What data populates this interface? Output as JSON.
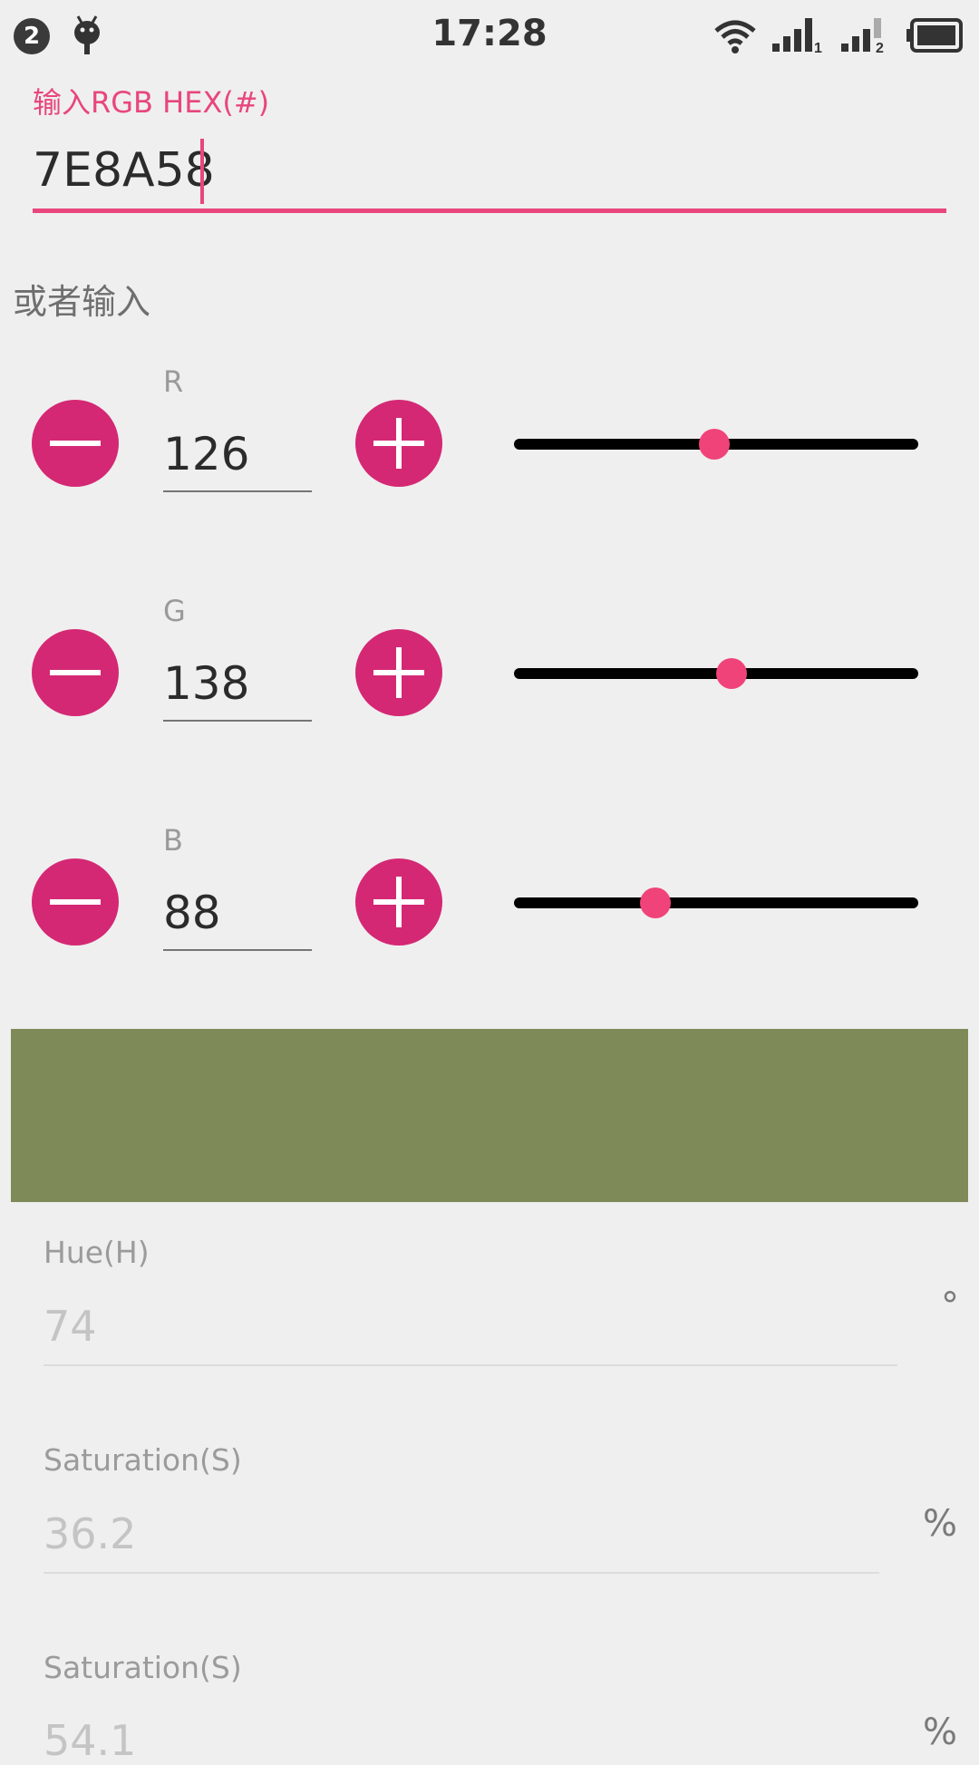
{
  "status_bar": {
    "notification_count": "2",
    "time": "17:28",
    "sim1_label": "1",
    "sim2_label": "2"
  },
  "hex_input": {
    "label": "输入RGB HEX(#)",
    "value": "7E8A58"
  },
  "or_label": "或者输入",
  "channels": [
    {
      "label": "R",
      "value": "126",
      "level": 0.494
    },
    {
      "label": "G",
      "value": "138",
      "level": 0.541
    },
    {
      "label": "B",
      "value": "88",
      "level": 0.345
    }
  ],
  "preview_color": "#7E8A58",
  "accent_color": "#E8467C",
  "button_color": "#D42874",
  "hsv": [
    {
      "label": "Hue(H)",
      "value": "74",
      "unit": "°"
    },
    {
      "label": "Saturation(S)",
      "value": "36.2",
      "unit": "%"
    },
    {
      "label": "Saturation(S)",
      "value": "54.1",
      "unit": "%"
    }
  ]
}
